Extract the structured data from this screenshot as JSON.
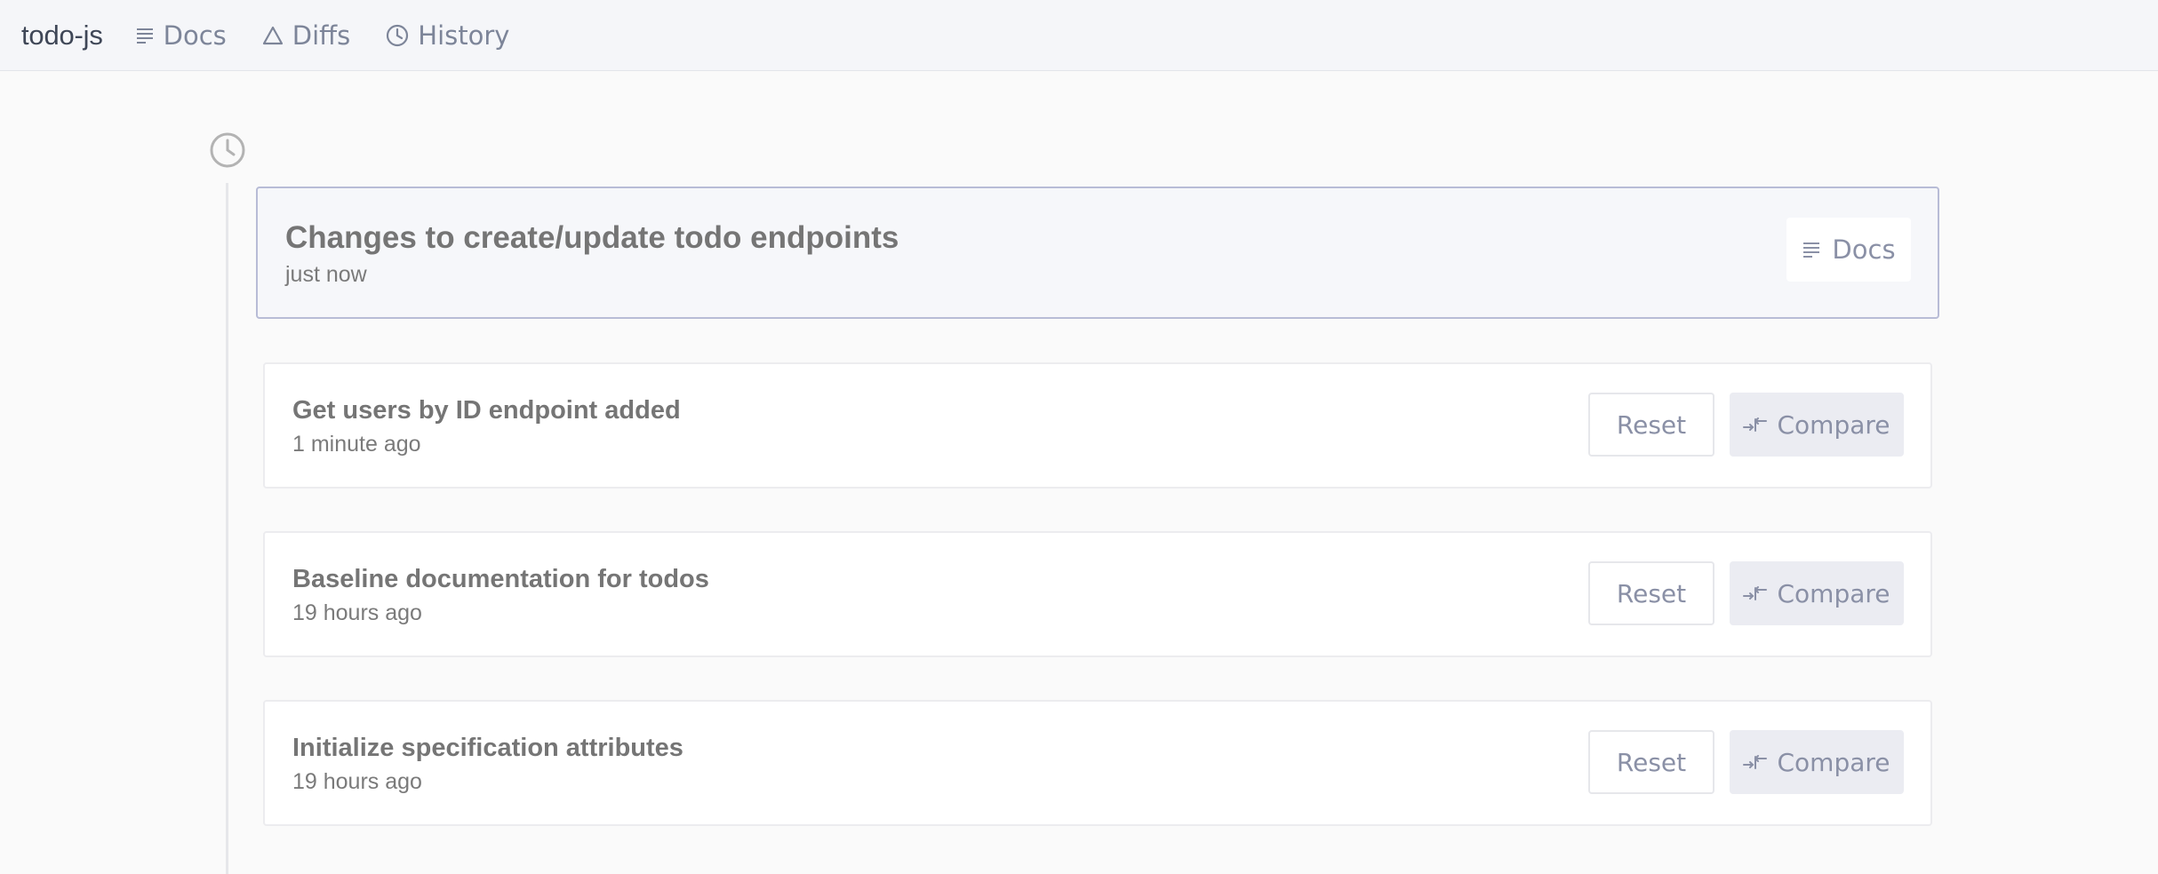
{
  "app": {
    "name": "todo-js"
  },
  "nav": [
    {
      "label": "Docs",
      "icon": "docs-icon"
    },
    {
      "label": "Diffs",
      "icon": "triangle-icon"
    },
    {
      "label": "History",
      "icon": "clock-icon"
    }
  ],
  "current": {
    "title": "Changes to create/update todo endpoints",
    "time": "just now",
    "docs_label": "Docs"
  },
  "entries": [
    {
      "title": "Get users by ID endpoint added",
      "time": "1 minute ago",
      "reset_label": "Reset",
      "compare_label": "Compare"
    },
    {
      "title": "Baseline documentation for todos",
      "time": "19 hours ago",
      "reset_label": "Reset",
      "compare_label": "Compare"
    },
    {
      "title": "Initialize specification attributes",
      "time": "19 hours ago",
      "reset_label": "Reset",
      "compare_label": "Compare"
    }
  ],
  "colors": {
    "accent_border": "#b8bcd6",
    "muted_text": "#7d8599",
    "compare_bg": "#ebecf2"
  }
}
